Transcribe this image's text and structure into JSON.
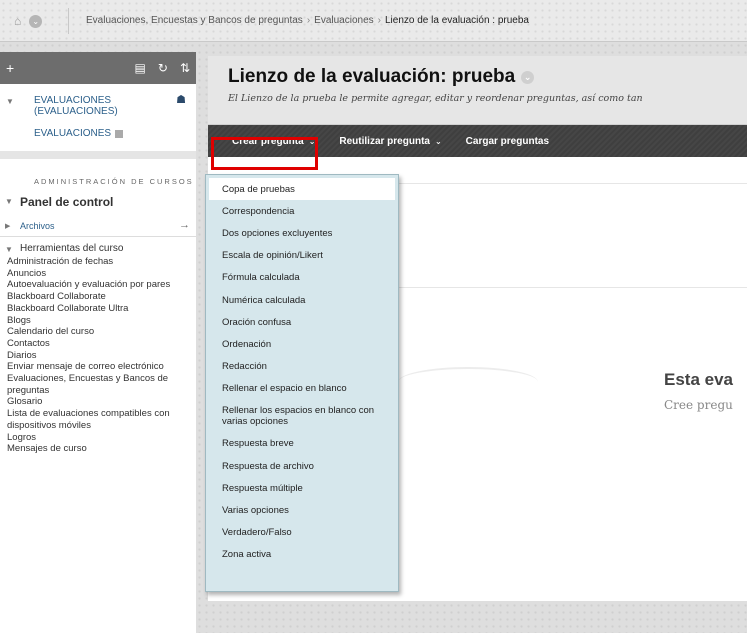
{
  "breadcrumb": {
    "items": [
      "Evaluaciones, Encuestas y Bancos de preguntas",
      "Evaluaciones"
    ],
    "separator": "›",
    "current": "Lienzo de la evaluación : prueba"
  },
  "sidebar": {
    "top_plus": "+",
    "course_name": "EVALUACIONES (EVALUACIONES)",
    "course_link": "EVALUACIONES",
    "admin_heading": "ADMINISTRACIÓN DE CURSOS",
    "panel_title": "Panel de control",
    "files_label": "Archivos",
    "tools_label": "Herramientas del curso",
    "tools": [
      "Administración de fechas",
      "Anuncios",
      "Autoevaluación y evaluación por pares",
      "Blackboard Collaborate",
      "Blackboard Collaborate Ultra",
      "Blogs",
      "Calendario del curso",
      "Contactos",
      "Diarios",
      "Enviar mensaje de correo electrónico",
      "Evaluaciones, Encuestas y Bancos de preguntas",
      "Glosario",
      "Lista de evaluaciones compatibles con dispositivos móviles",
      "Logros",
      "Mensajes de curso"
    ]
  },
  "page": {
    "title": "Lienzo de la evaluación: prueba",
    "description": "El Lienzo de la prueba le permite agregar, editar y reordenar preguntas, así como tan"
  },
  "actions": {
    "create_question": "Crear pregunta",
    "reuse_question": "Reutilizar pregunta",
    "upload_questions": "Cargar preguntas"
  },
  "dropdown": {
    "items": [
      "Copa de pruebas",
      "Correspondencia",
      "Dos opciones excluyentes",
      "Escala de opinión/Likert",
      "Fórmula calculada",
      "Numérica calculada",
      "Oración confusa",
      "Ordenación",
      "Redacción",
      "Rellenar el espacio en blanco",
      "Rellenar los espacios en blanco con varias opciones",
      "Respuesta breve",
      "Respuesta de archivo",
      "Respuesta múltiple",
      "Varias opciones",
      "Verdadero/Falso",
      "Zona activa"
    ]
  },
  "empty_state": {
    "title": "Esta eva",
    "text": "Cree pregu"
  },
  "colors": {
    "highlight_border": "#e00000",
    "action_bar": "#424242",
    "dropdown_bg": "#d6e7ec",
    "link": "#2b5f8a"
  }
}
